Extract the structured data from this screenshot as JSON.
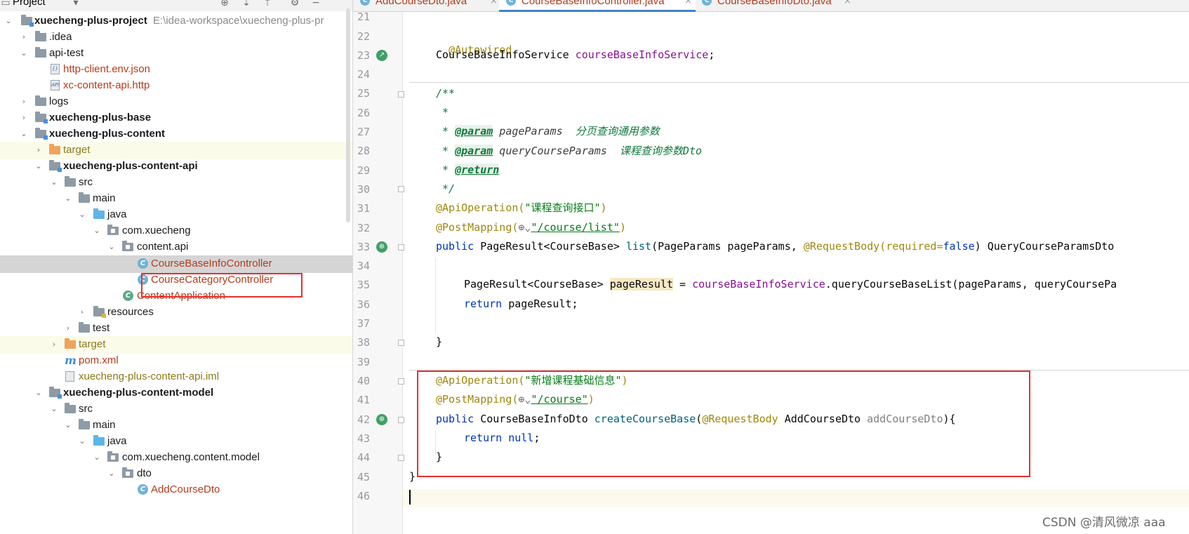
{
  "project_panel": {
    "title": "Project"
  },
  "tree": [
    {
      "label": "xuecheng-plus-project",
      "path": "E:\\idea-workspace\\xuecheng-plus-pr"
    },
    {
      "label": ".idea"
    },
    {
      "label": "api-test"
    },
    {
      "label": "http-client.env.json"
    },
    {
      "label": "xc-content-api.http"
    },
    {
      "label": "logs"
    },
    {
      "label": "xuecheng-plus-base"
    },
    {
      "label": "xuecheng-plus-content"
    },
    {
      "label": "target"
    },
    {
      "label": "xuecheng-plus-content-api"
    },
    {
      "label": "src"
    },
    {
      "label": "main"
    },
    {
      "label": "java"
    },
    {
      "label": "com.xuecheng"
    },
    {
      "label": "content.api"
    },
    {
      "label": "CourseBaseInfoController"
    },
    {
      "label": "CourseCategoryController"
    },
    {
      "label": "ContentApplication"
    },
    {
      "label": "resources"
    },
    {
      "label": "test"
    },
    {
      "label": "target"
    },
    {
      "label": "pom.xml"
    },
    {
      "label": "xuecheng-plus-content-api.iml"
    },
    {
      "label": "xuecheng-plus-content-model"
    },
    {
      "label": "src"
    },
    {
      "label": "main"
    },
    {
      "label": "java"
    },
    {
      "label": "com.xuecheng.content.model"
    },
    {
      "label": "dto"
    },
    {
      "label": "AddCourseDto"
    }
  ],
  "tabs": [
    {
      "label": "AddCourseDto.java",
      "close": "×"
    },
    {
      "label": "CourseBaseInfoController.java",
      "close": "×"
    },
    {
      "label": "CourseBaseInfoDto.java",
      "close": "×"
    }
  ],
  "line_numbers": [
    "21",
    "22",
    "23",
    "24",
    "25",
    "26",
    "27",
    "28",
    "29",
    "30",
    "31",
    "32",
    "33",
    "34",
    "35",
    "36",
    "37",
    "38",
    "39",
    "40",
    "41",
    "42",
    "43",
    "44",
    "45",
    "46"
  ],
  "code": {
    "l22": [
      "@Autowired"
    ],
    "l23": [
      "CourseBaseInfoService ",
      "courseBaseInfoService",
      ";"
    ],
    "l25": [
      "/**"
    ],
    "l26": [
      " *"
    ],
    "l27": [
      " * ",
      "@param",
      " pageParams  ",
      "分页查询通用参数"
    ],
    "l28": [
      " * ",
      "@param",
      " queryCourseParams  ",
      "课程查询参数Dto"
    ],
    "l29": [
      " * ",
      "@return"
    ],
    "l30": [
      " */"
    ],
    "l31": [
      "@ApiOperation(",
      "\"课程查询接口\"",
      ")"
    ],
    "l32": [
      "@PostMapping(",
      "⊕⌄",
      "\"/course/list\"",
      ")"
    ],
    "l33": [
      "public ",
      "PageResult<CourseBase> ",
      "list",
      "(PageParams pageParams, ",
      "@RequestBody(required=",
      "false",
      ") QueryCourseParamsDto"
    ],
    "l35": [
      "PageResult<CourseBase> ",
      "pageResult",
      " = ",
      "courseBaseInfoService",
      ".queryCourseBaseList(pageParams, queryCoursePa"
    ],
    "l36": [
      "return ",
      "pageResult;"
    ],
    "l38": [
      "}"
    ],
    "l40": [
      "@ApiOperation(",
      "\"新增课程基础信息\"",
      ")"
    ],
    "l41": [
      "@PostMapping(",
      "⊕⌄",
      "\"/course\"",
      ")"
    ],
    "l42": [
      "public ",
      "CourseBaseInfoDto ",
      "createCourseBase",
      "(",
      "@RequestBody ",
      "AddCourseDto ",
      "addCourseDto",
      "){"
    ],
    "l43": [
      "return ",
      "null",
      ";"
    ],
    "l44": [
      "}"
    ],
    "l45": [
      "}"
    ]
  },
  "colors": {
    "highlight_box": "#e5312e",
    "tab_underline": "#4083c9",
    "annotation": "#9e880d",
    "keyword": "#0033b3",
    "string": "#067d17"
  },
  "watermark": "CSDN @清风微凉 aaa"
}
